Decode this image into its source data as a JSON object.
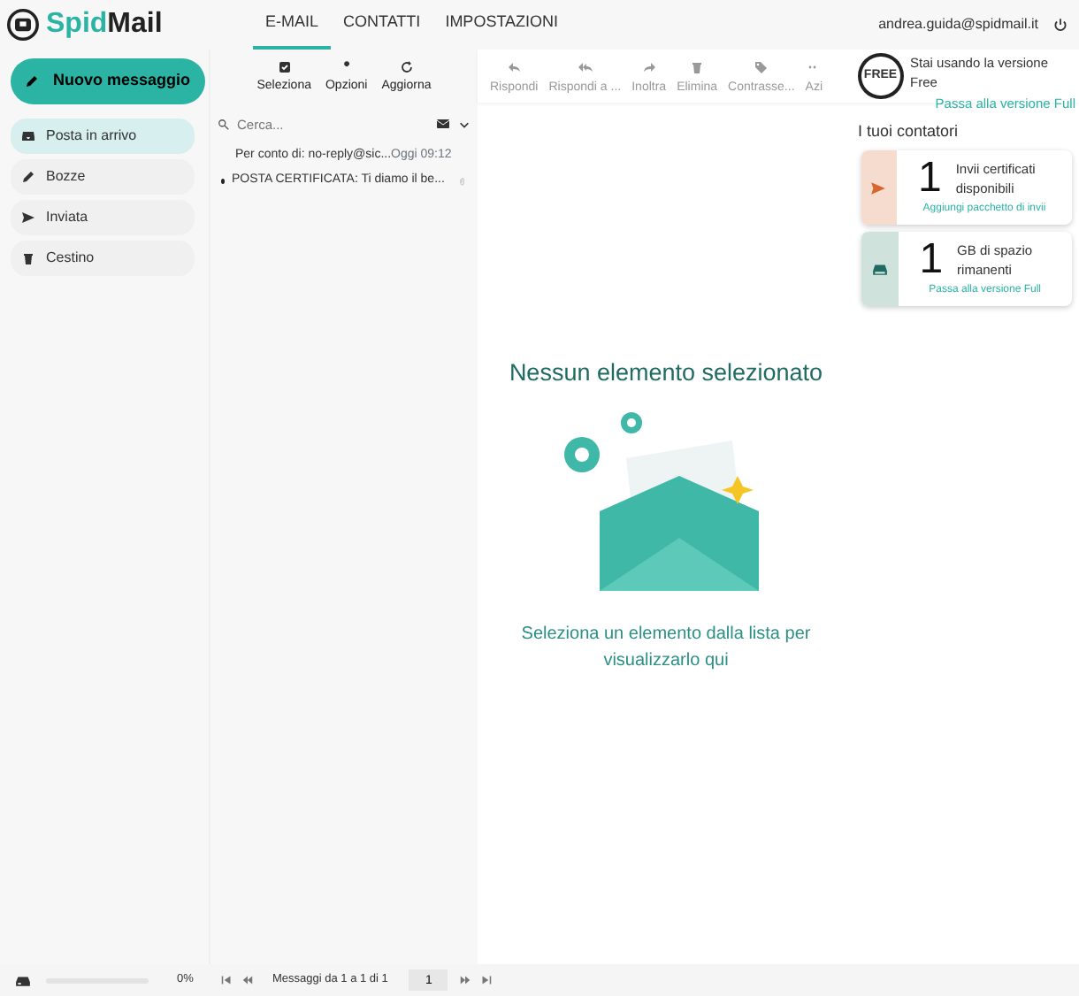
{
  "brand": {
    "prefix": "Spid",
    "suffix": "Mail"
  },
  "tabs": [
    {
      "label": "E-MAIL",
      "selected": true
    },
    {
      "label": "CONTATTI",
      "selected": false
    },
    {
      "label": "IMPOSTAZIONI",
      "selected": false
    }
  ],
  "user": {
    "email": "andrea.guida@spidmail.it"
  },
  "compose": {
    "label": "Nuovo messaggio"
  },
  "folders": [
    {
      "kind": "inbox",
      "label": "Posta in arrivo",
      "selected": true
    },
    {
      "kind": "drafts",
      "label": "Bozze",
      "selected": false
    },
    {
      "kind": "sent",
      "label": "Inviata",
      "selected": false
    },
    {
      "kind": "trash",
      "label": "Cestino",
      "selected": false
    }
  ],
  "list_toolbar": [
    {
      "kind": "select",
      "label": "Seleziona"
    },
    {
      "kind": "options",
      "label": "Opzioni"
    },
    {
      "kind": "refresh",
      "label": "Aggiorna"
    }
  ],
  "search": {
    "placeholder": "Cerca..."
  },
  "messages": [
    {
      "sender": "Per conto di: no-reply@sic...",
      "time": "Oggi 09:12",
      "subject": "POSTA CERTIFICATA: Ti diamo il be...",
      "unread": true,
      "attachment": true
    }
  ],
  "actions": [
    {
      "kind": "reply",
      "label": "Rispondi",
      "disabled": true
    },
    {
      "kind": "reply-all",
      "label": "Rispondi a ...",
      "disabled": true
    },
    {
      "kind": "forward",
      "label": "Inoltra",
      "disabled": true
    },
    {
      "kind": "delete",
      "label": "Elimina",
      "disabled": true
    },
    {
      "kind": "tag",
      "label": "Contrasse...",
      "disabled": true
    },
    {
      "kind": "more",
      "label": "Azi",
      "disabled": true
    }
  ],
  "empty_state": {
    "title": "Nessun elemento selezionato",
    "text": "Seleziona un elemento dalla lista per visualizzarlo qui"
  },
  "plan": {
    "badge": "FREE",
    "text": "Stai usando la versione Free",
    "link": "Passa alla versione Full"
  },
  "counters_title": "I tuoi contatori",
  "counters": [
    {
      "kind": "send",
      "color": "#f6dccf",
      "value": "1",
      "label": "Invii certificati disponibili",
      "link": "Aggiungi pacchetto di invii"
    },
    {
      "kind": "storage",
      "color": "#cfe3dc",
      "value": "1",
      "label": "GB di spazio rimanenti",
      "link": "Passa alla versione Full"
    }
  ],
  "footer": {
    "storage": {
      "level": 0,
      "reading": "0%"
    },
    "pager_text": "Messaggi da 1 a 1 di 1",
    "page": "1"
  }
}
